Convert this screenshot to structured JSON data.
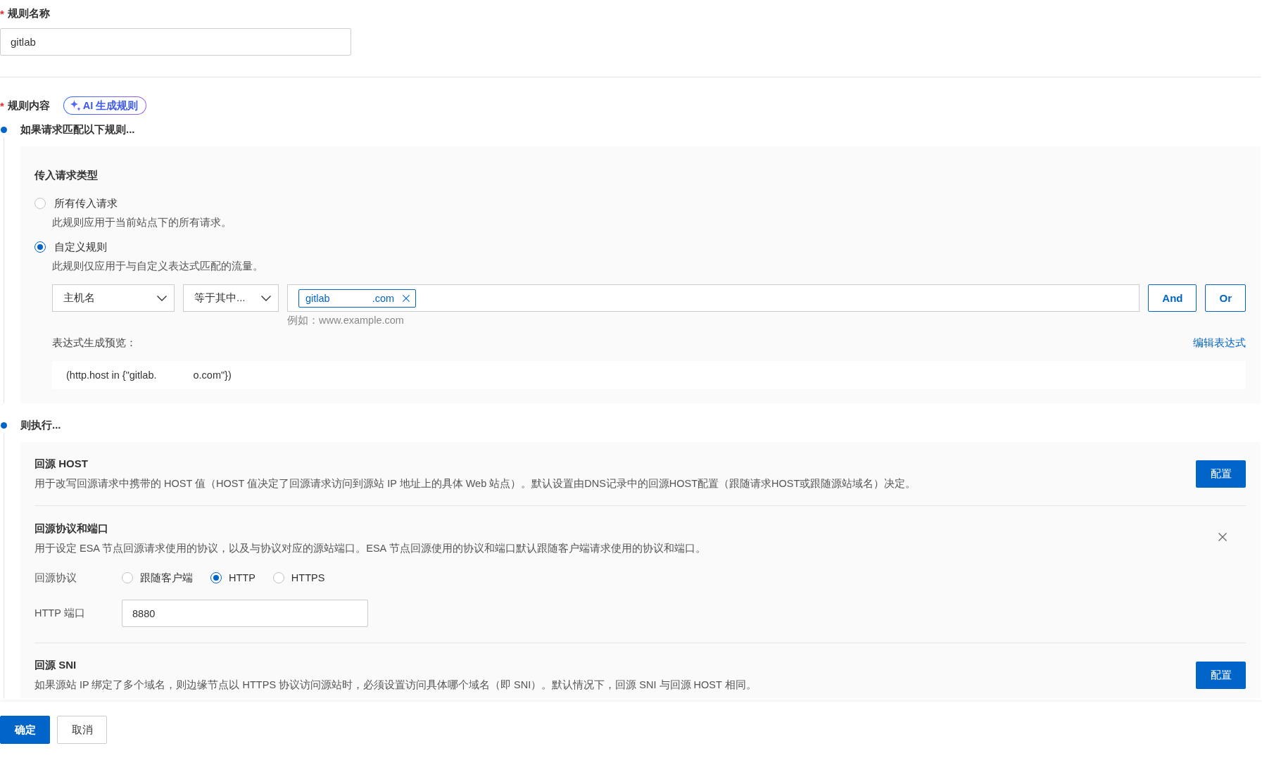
{
  "rule_name": {
    "required_mark": "*",
    "label": "规则名称",
    "value": "gitlab"
  },
  "rule_content": {
    "required_mark": "*",
    "label": "规则内容",
    "ai_button": "AI 生成规则"
  },
  "steps": [
    {
      "kind": "condition",
      "heading": "如果请求匹配以下规则...",
      "section_title": "传入请求类型",
      "options": [
        {
          "label": "所有传入请求",
          "description": "此规则应用于当前站点下的所有请求。",
          "selected": false
        },
        {
          "label": "自定义规则",
          "description": "此规则仅应用于与自定义表达式匹配的流量。",
          "selected": true
        }
      ],
      "builder": {
        "field": "主机名",
        "operator": "等于其中...",
        "tags": [
          {
            "parts": [
              "gitlab",
              ".com"
            ]
          }
        ],
        "hint": "例如：www.example.com",
        "buttons": [
          "And",
          "Or"
        ]
      },
      "preview": {
        "label": "表达式生成预览：",
        "edit_link": "编辑表达式",
        "parts": [
          "(http.host in {\"gitlab.",
          "o.com\"})"
        ]
      }
    },
    {
      "kind": "actions",
      "heading": "则执行...",
      "items": [
        {
          "kind": "config",
          "title": "回源 HOST",
          "description": "用于改写回源请求中携带的 HOST 值（HOST 值决定了回源请求访问到源站 IP 地址上的具体 Web 站点）。默认设置由DNS记录中的回源HOST配置（跟随请求HOST或跟随源站域名）决定。",
          "button": "配置"
        },
        {
          "kind": "form",
          "title": "回源协议和端口",
          "description": "用于设定 ESA 节点回源请求使用的协议，以及与协议对应的源站端口。ESA 节点回源使用的协议和端口默认跟随客户端请求使用的协议和端口。",
          "removable": true,
          "protocol": {
            "label": "回源协议",
            "options": [
              {
                "label": "跟随客户端",
                "selected": false
              },
              {
                "label": "HTTP",
                "selected": true
              },
              {
                "label": "HTTPS",
                "selected": false
              }
            ]
          },
          "port": {
            "label": "HTTP 端口",
            "value": "8880"
          }
        },
        {
          "kind": "config",
          "title": "回源 SNI",
          "description": "如果源站 IP 绑定了多个域名，则边缘节点以 HTTPS 协议访问源站时，必须设置访问具体哪个域名（即 SNI）。默认情况下，回源 SNI 与回源 HOST 相同。",
          "button": "配置"
        }
      ]
    }
  ],
  "footer": {
    "buttons": [
      {
        "label": "确定",
        "kind": "primary"
      },
      {
        "label": "取消",
        "kind": "default"
      }
    ]
  }
}
